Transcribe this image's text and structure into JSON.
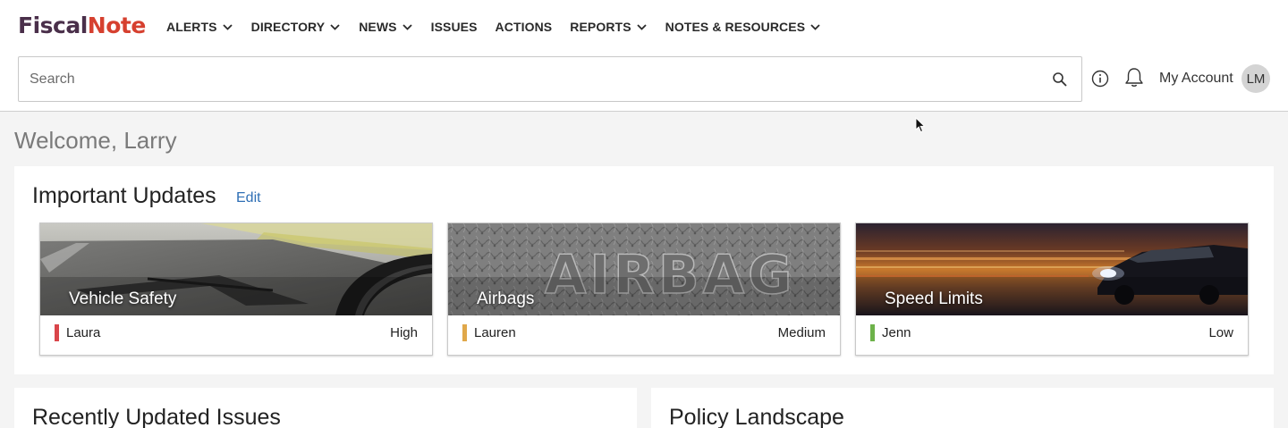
{
  "logo": {
    "part1": "Fiscal",
    "part2": "Note"
  },
  "nav": [
    {
      "label": "ALERTS",
      "dropdown": true
    },
    {
      "label": "DIRECTORY",
      "dropdown": true
    },
    {
      "label": "NEWS",
      "dropdown": true
    },
    {
      "label": "ISSUES",
      "dropdown": false
    },
    {
      "label": "ACTIONS",
      "dropdown": false
    },
    {
      "label": "REPORTS",
      "dropdown": true
    },
    {
      "label": "NOTES & RESOURCES",
      "dropdown": true
    }
  ],
  "search": {
    "placeholder": "Search",
    "value": ""
  },
  "account": {
    "label": "My Account",
    "initials": "LM"
  },
  "welcome": "Welcome, Larry",
  "updates": {
    "title": "Important Updates",
    "edit_label": "Edit",
    "cards": [
      {
        "title": "Vehicle Safety",
        "owner": "Laura",
        "priority": "High",
        "priority_color": "#d9454a",
        "image": "road-dashboard"
      },
      {
        "title": "Airbags",
        "owner": "Lauren",
        "priority": "Medium",
        "priority_color": "#e0a84a",
        "image": "airbag-emblem"
      },
      {
        "title": "Speed Limits",
        "owner": "Jenn",
        "priority": "Low",
        "priority_color": "#6db24a",
        "image": "car-motion"
      }
    ]
  },
  "recent": {
    "title": "Recently Updated Issues"
  },
  "policy": {
    "title": "Policy Landscape"
  },
  "colors": {
    "brand_dark": "#4a2f4a",
    "brand_red": "#d6402f",
    "link": "#2f6fb5"
  }
}
